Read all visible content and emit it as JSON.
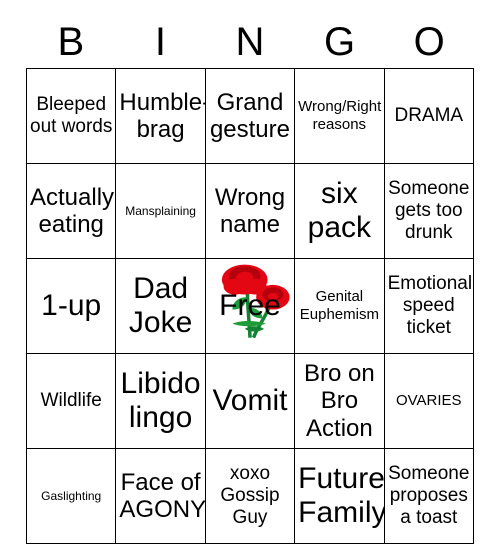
{
  "header": {
    "letters": [
      "B",
      "I",
      "N",
      "G",
      "O"
    ]
  },
  "colors": {
    "grid_line": "#000000",
    "text": "#000000",
    "background": "#ffffff",
    "rose_red": "#e30613",
    "rose_red_dark": "#b3000c",
    "leaf_green": "#1f9c3a",
    "stem_green": "#148233"
  },
  "grid": {
    "rows": [
      [
        {
          "label": "Bleeped out words",
          "size": "m",
          "marked": false
        },
        {
          "label": "Humble-brag",
          "size": "l",
          "marked": false
        },
        {
          "label": "Grand gesture",
          "size": "l",
          "marked": false
        },
        {
          "label": "Wrong/Right reasons",
          "size": "s",
          "marked": false
        },
        {
          "label": "DRAMA",
          "size": "m",
          "marked": false
        }
      ],
      [
        {
          "label": "Actually eating",
          "size": "l",
          "marked": false
        },
        {
          "label": "Mansplaining",
          "size": "xs",
          "marked": false
        },
        {
          "label": "Wrong name",
          "size": "l",
          "marked": false
        },
        {
          "label": "six pack",
          "size": "xl",
          "marked": false
        },
        {
          "label": "Someone gets too drunk",
          "size": "m",
          "marked": false
        }
      ],
      [
        {
          "label": "1-up",
          "size": "xl",
          "marked": false
        },
        {
          "label": "Dad Joke",
          "size": "xl",
          "marked": false
        },
        {
          "label": "Free",
          "size": "xl",
          "marked": true,
          "free": true
        },
        {
          "label": "Genital Euphemism",
          "size": "s",
          "marked": false
        },
        {
          "label": "Emotional speed ticket",
          "size": "m",
          "marked": false
        }
      ],
      [
        {
          "label": "Wildlife",
          "size": "m",
          "marked": false
        },
        {
          "label": "Libido lingo",
          "size": "xl",
          "marked": false
        },
        {
          "label": "Vomit",
          "size": "xl",
          "marked": false
        },
        {
          "label": "Bro on Bro Action",
          "size": "l",
          "marked": false
        },
        {
          "label": "OVARIES",
          "size": "s",
          "marked": false
        }
      ],
      [
        {
          "label": "Gaslighting",
          "size": "xs",
          "marked": false
        },
        {
          "label": "Face of AGONY",
          "size": "l",
          "marked": false
        },
        {
          "label": "xoxo Gossip Guy",
          "size": "m",
          "marked": false
        },
        {
          "label": "Future Family",
          "size": "xl",
          "marked": false
        },
        {
          "label": "Someone proposes a toast",
          "size": "m",
          "marked": false
        }
      ]
    ]
  },
  "free_space": {
    "label": "Free",
    "stamp_icon": "roses-icon"
  }
}
